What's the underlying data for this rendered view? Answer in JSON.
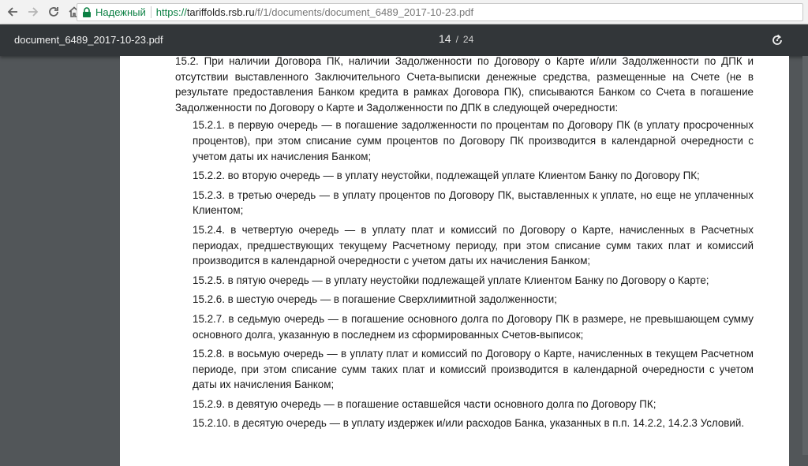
{
  "browser": {
    "secure_label": "Надежный",
    "url_scheme": "https://",
    "url_host": "tariffolds.rsb.ru",
    "url_path": "/f/1/documents/document_6489_2017-10-23.pdf",
    "icons": [
      "back-icon",
      "forward-icon",
      "reload-icon",
      "home-icon",
      "lock-icon"
    ]
  },
  "viewer": {
    "file_name": "document_6489_2017-10-23.pdf",
    "page_current": "14",
    "page_total": "24",
    "icons": [
      "rotate-icon"
    ]
  },
  "document": {
    "intro": "15.2. При наличии Договора ПК, наличии Задолженности по Договору о Карте и/или Задолженности по ДПК и отсутствии выставленного Заключительного Счета-выписки денежные средства, размещенные на Счете (не в результате предоставления Банком кредита в рамках Договора ПК), списываются Банком со Счета в погашение Задолженности по Договору о Карте и Задолженности по ДПК в следующей очередности:",
    "items": [
      "15.2.1. в первую очередь — в погашение задолженности по процентам по Договору ПК (в уплату просроченных процентов), при этом списание сумм процентов по Договору ПК производится в календарной очередности с учетом даты их начисления Банком;",
      "15.2.2. во вторую очередь — в уплату неустойки, подлежащей уплате Клиентом Банку по Договору ПК;",
      "15.2.3. в третью очередь — в уплату процентов по Договору ПК, выставленных к уплате, но еще не уплаченных Клиентом;",
      "15.2.4. в четвертую очередь — в уплату плат и комиссий по Договору о Карте, начисленных в Расчетных периодах, предшествующих текущему Расчетному периоду, при этом списание сумм таких плат и комиссий производится в календарной очередности с учетом даты их начисления Банком;",
      "15.2.5. в пятую очередь — в уплату неустойки подлежащей уплате Клиентом Банку по Договору о Карте;",
      "15.2.6. в шестую очередь — в погашение Сверхлимитной задолженности;",
      "15.2.7. в седьмую очередь — в погашение основного долга по Договору ПК в размере, не превышающем сумму основного долга, указанную в последнем из сформированных Счетов-выписок;",
      "15.2.8. в восьмую очередь — в уплату плат и комиссий по Договору о Карте, начисленных в текущем Расчетном периоде, при этом списание сумм таких плат и комиссий производится в календарной очередности с учетом даты их начисления Банком;",
      "15.2.9. в девятую очередь — в погашение оставшейся части основного долга по Договору ПК;",
      "15.2.10. в десятую очередь — в уплату издержек и/или расходов Банка, указанных в п.п. 14.2.2, 14.2.3 Условий."
    ]
  }
}
